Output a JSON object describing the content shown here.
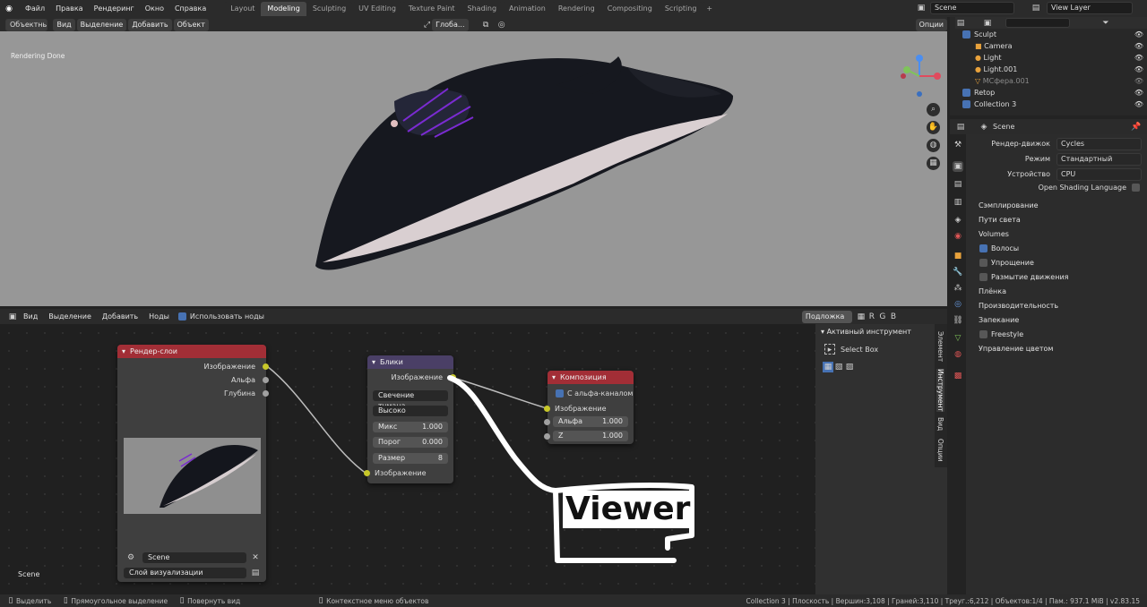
{
  "topbar": {
    "menus": [
      "Файл",
      "Правка",
      "Рендеринг",
      "Окно",
      "Справка"
    ],
    "workspaces": [
      "Layout",
      "Modeling",
      "Sculpting",
      "UV Editing",
      "Texture Paint",
      "Shading",
      "Animation",
      "Rendering",
      "Compositing",
      "Scripting"
    ],
    "active_workspace": "Modeling",
    "add_tab": "+",
    "scene": "Scene",
    "view_layer": "View Layer"
  },
  "viewport": {
    "mode": "Объектный ...",
    "menus": [
      "Вид",
      "Выделение",
      "Добавить",
      "Объект"
    ],
    "transform": "Глоба...",
    "options": "Опции",
    "status_text": "Rendering Done"
  },
  "node_editor": {
    "menus": [
      "Вид",
      "Выделение",
      "Добавить",
      "Ноды"
    ],
    "use_nodes": "Использовать ноды",
    "backdrop": "Подложка",
    "channels": [
      "R",
      "G",
      "B"
    ],
    "scene_label": "Scene",
    "render_layers": {
      "title": "Рендер-слои",
      "outputs": [
        "Изображение",
        "Альфа",
        "Глубина"
      ],
      "scene": "Scene",
      "layer": "Слой визуализации"
    },
    "glare": {
      "title": "Блики",
      "output": "Изображение",
      "type": "Свечение тумана",
      "quality": "Высоко",
      "mix_label": "Микс",
      "mix_value": "1.000",
      "threshold_label": "Порог",
      "threshold_value": "0.000",
      "size_label": "Размер",
      "size_value": "8",
      "input": "Изображение"
    },
    "composite": {
      "title": "Композиция",
      "use_alpha": "С альфа-каналом",
      "image": "Изображение",
      "alpha_label": "Альфа",
      "alpha_value": "1.000",
      "z_label": "Z",
      "z_value": "1.000"
    },
    "annotation": "Viewer"
  },
  "npanel": {
    "section": "Активный инструмент",
    "tool": "Select Box",
    "tabs": [
      "Элемент",
      "Инструмент",
      "Вид",
      "Опции"
    ]
  },
  "outliner": {
    "items": [
      {
        "name": "Sculpt",
        "indent": 0
      },
      {
        "name": "Camera",
        "indent": 1
      },
      {
        "name": "Light",
        "indent": 1
      },
      {
        "name": "Light.001",
        "indent": 1
      },
      {
        "name": "MCфера.001",
        "indent": 1
      },
      {
        "name": "Retop",
        "indent": 0
      },
      {
        "name": "Collection 3",
        "indent": 0
      }
    ]
  },
  "properties": {
    "scene": "Scene",
    "engine_label": "Рендер-движок",
    "engine": "Cycles",
    "mode_label": "Режим",
    "mode": "Стандартный",
    "device_label": "Устройство",
    "device": "CPU",
    "osl": "Open Shading Language",
    "panels": [
      "Сэмплирование",
      "Пути света",
      "Volumes",
      "Волосы",
      "Упрощение",
      "Размытие движения",
      "Плёнка",
      "Производительность",
      "Запекание",
      "Freestyle",
      "Управление цветом"
    ]
  },
  "statusbar": {
    "select": "Выделить",
    "box": "Прямоугольное выделение",
    "rotate": "Повернуть вид",
    "context": "Контекстное меню объектов",
    "stats": "Collection 3 | Плоскость | Вершин:3,108 | Граней:3,110 | Треуг.:6,212 | Объектов:1/4 | Пам.: 937.1 MiB | v2.83.15"
  },
  "colors": {
    "render_layers_header": "#a22e36",
    "glare_header": "#4a3f66",
    "composite_header": "#a22e36",
    "accent": "#4772b3"
  }
}
